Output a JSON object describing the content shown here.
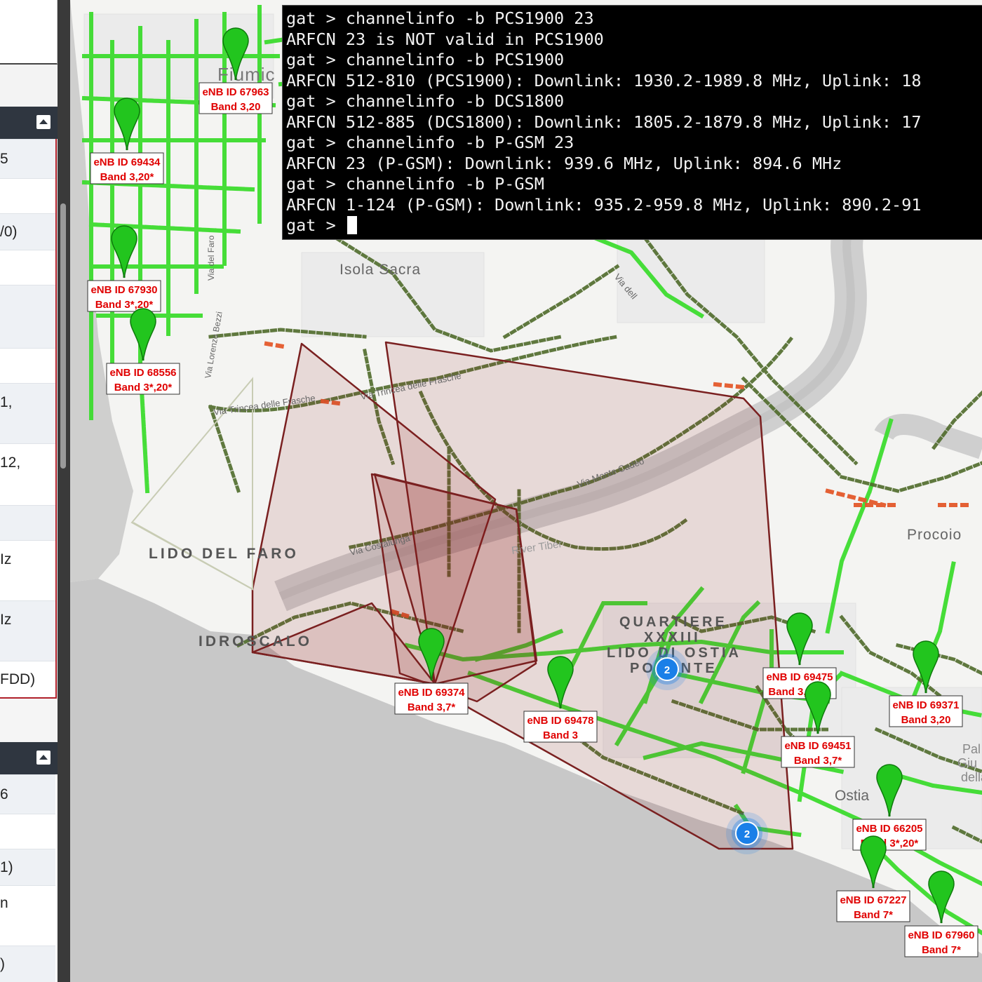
{
  "left_panel": {
    "rows_top": [
      {
        "text": "5"
      },
      {
        "text": ""
      },
      {
        "text": "/0)"
      },
      {
        "text": ""
      },
      {
        "text": ""
      },
      {
        "text": ""
      },
      {
        "text": "1,"
      },
      {
        "text": "12,"
      },
      {
        "text": ""
      },
      {
        "text": "Iz"
      },
      {
        "text": "Iz"
      },
      {
        "text": "FDD)"
      }
    ],
    "rows_bottom": [
      {
        "text": "6"
      },
      {
        "text": ""
      },
      {
        "text": "1)"
      },
      {
        "text": "n"
      },
      {
        "text": ")"
      }
    ]
  },
  "terminal": {
    "lines": [
      "gat > channelinfo -b PCS1900 23",
      "ARFCN 23 is NOT valid in PCS1900",
      "gat > channelinfo -b PCS1900",
      "ARFCN 512-810 (PCS1900): Downlink: 1930.2-1989.8 MHz, Uplink: 18",
      "gat > channelinfo -b DCS1800",
      "ARFCN 512-885 (DCS1800): Downlink: 1805.2-1879.8 MHz, Uplink: 17",
      "gat > channelinfo -b P-GSM 23",
      "ARFCN 23 (P-GSM): Downlink: 939.6 MHz, Uplink: 894.6 MHz",
      "gat > channelinfo -b P-GSM",
      "ARFCN 1-124 (P-GSM): Downlink: 935.2-959.8 MHz, Uplink: 890.2-91"
    ],
    "prompt": "gat > "
  },
  "map": {
    "place_labels": {
      "fiumicino": "Fiumic",
      "isola_sacra": "Isola Sacra",
      "lido_del_faro": "LIDO DEL FARO",
      "idroscalo": "IDROSCALO",
      "quartiere": "QUARTIERE",
      "xxxiii": "XXXIII",
      "lido_di_ostia": "LIDO DI OSTIA",
      "ponente": "PONENTE",
      "procoio": "Procoio",
      "ostia": "Ostia",
      "river_tiber": "River Tiber",
      "via_monte_cadeo": "Via Monte Cadeo",
      "via_trincea_1": "Via Trincea delle Frasche",
      "via_trincea_2": "Via Trincea delle Frasche",
      "via_costalunga": "Via Costalunga",
      "via_bezzi": "Via Lorenzo Bezzi",
      "via_faro": "Via del Faro",
      "via_dell": "Via dell",
      "pal": "Pal",
      "giu": "Giu",
      "della": "della"
    },
    "pins": [
      {
        "id": "eNB ID 67963",
        "band": "Band 3,20"
      },
      {
        "id": "eNB ID 69434",
        "band": "Band 3,20*"
      },
      {
        "id": "eNB ID 67930",
        "band": "Band 3*,20*"
      },
      {
        "id": "eNB ID 68556",
        "band": "Band 3*,20*"
      },
      {
        "id": "eNB ID 69374",
        "band": "Band 3,7*"
      },
      {
        "id": "eNB ID 69478",
        "band": "Band 3"
      },
      {
        "id": "eNB ID 69475",
        "band": "Band 3,7*,20"
      },
      {
        "id": "eNB ID 69371",
        "band": "Band 3,20"
      },
      {
        "id": "eNB ID 69451",
        "band": "Band 3,7*"
      },
      {
        "id": "eNB ID 66205",
        "band": "Band 3*,20*"
      },
      {
        "id": "eNB ID 67227",
        "band": "Band 7*"
      },
      {
        "id": "eNB ID 67960",
        "band": "Band 7*"
      }
    ],
    "clusters": [
      {
        "count": "2"
      },
      {
        "count": "2"
      }
    ],
    "colors": {
      "pin": "#22c51e",
      "pin_dark": "#0e7a0c",
      "label_text": "#e00000",
      "polygon_fill": "#8b1a1a",
      "polygon_stroke": "#7a2020",
      "coverage_green": "#3ddc2f",
      "coverage_dark": "#4f6b2b",
      "coverage_red": "#e4592a",
      "cluster": "#1a7fe8",
      "water": "#c7c7c7",
      "river": "#c9c9c9"
    }
  }
}
